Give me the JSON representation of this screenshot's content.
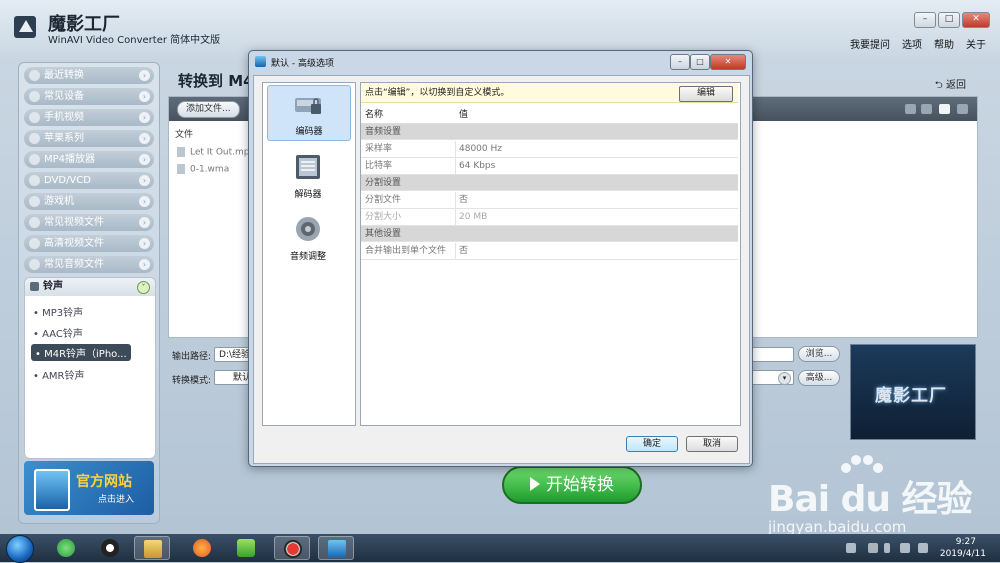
{
  "app": {
    "title": "魔影工厂",
    "subtitle": "WinAVI Video Converter 简体中文版",
    "window_buttons": [
      "–",
      "□",
      "✕"
    ],
    "menu": [
      "我要提问",
      "选项",
      "帮助",
      "关于"
    ]
  },
  "sidebar": {
    "items": [
      {
        "label": "最近转换",
        "icon": "clock-icon"
      },
      {
        "label": "常见设备",
        "icon": "device-icon"
      },
      {
        "label": "手机视频",
        "icon": "phone-icon"
      },
      {
        "label": "苹果系列",
        "icon": "apple-icon"
      },
      {
        "label": "MP4播放器",
        "icon": "mp4-icon"
      },
      {
        "label": "DVD/VCD",
        "icon": "disc-icon"
      },
      {
        "label": "游戏机",
        "icon": "gamepad-icon"
      },
      {
        "label": "常见视频文件",
        "icon": "film-icon"
      },
      {
        "label": "高清视频文件",
        "icon": "hd-icon"
      },
      {
        "label": "常见音频文件",
        "icon": "music-icon"
      }
    ],
    "ringtone": {
      "header": "铃声",
      "items": [
        "• MP3铃声",
        "• AAC铃声",
        "• M4R铃声（iPho...",
        "• AMR铃声"
      ],
      "selected_index": 2
    },
    "banner": {
      "title": "官方网站",
      "subtitle": "点击进入"
    }
  },
  "main": {
    "title": "转换到 M4",
    "back_label": "返回",
    "add_file_label": "添加文件...",
    "file_column": "文件",
    "files": [
      "Let It Out.mp",
      "0-1.wma"
    ],
    "output_path_label": "输出路径:",
    "output_path_value": "D:\\经验",
    "browse_label": "浏览...",
    "convert_mode_label": "转换模式:",
    "convert_mode_value": "默认",
    "advanced_label": "高级...",
    "preview_logo": "魔影工厂",
    "start_label": "开始转换"
  },
  "dialog": {
    "title": "默认 - 高级选项",
    "left_items": [
      {
        "label": "编码器",
        "icon": "encoder-icon"
      },
      {
        "label": "解码器",
        "icon": "decoder-icon"
      },
      {
        "label": "音频调整",
        "icon": "speaker-icon"
      }
    ],
    "tip": "点击“编辑”，以切换到自定义模式。",
    "edit_label": "编辑",
    "columns": {
      "name": "名称",
      "value": "值"
    },
    "groups": [
      {
        "title": "音频设置",
        "rows": [
          {
            "name": "采样率",
            "value": "48000 Hz",
            "disabled": false
          },
          {
            "name": "比特率",
            "value": "64 Kbps",
            "disabled": false
          }
        ]
      },
      {
        "title": "分割设置",
        "rows": [
          {
            "name": "分割文件",
            "value": "否",
            "disabled": false
          },
          {
            "name": "分割大小",
            "value": "20 MB",
            "disabled": true
          }
        ]
      },
      {
        "title": "其他设置",
        "rows": [
          {
            "name": "合并输出到单个文件",
            "value": "否",
            "disabled": false
          }
        ]
      }
    ],
    "ok_label": "确定",
    "cancel_label": "取消"
  },
  "taskbar": {
    "time": "9:27",
    "date": "2019/4/11"
  },
  "watermark": {
    "brand": "Bai du 经验",
    "url": "jingyan.baidu.com"
  }
}
